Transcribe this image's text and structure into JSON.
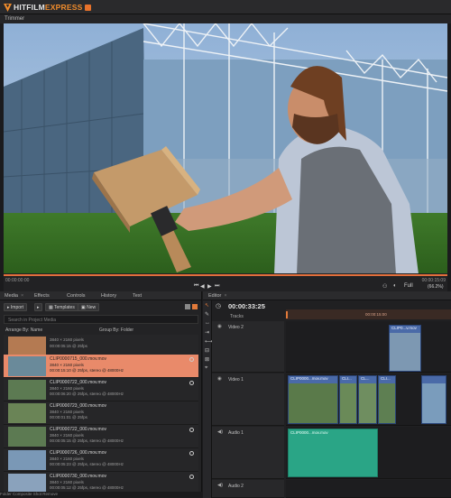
{
  "app": {
    "brand_hit": "HITFILM",
    "brand_express": "EXPRESS",
    "colors": {
      "accent": "#f08c2c",
      "selection": "#e98a6a",
      "audio_clip": "#2aa586",
      "video_clip": "#4a6aa8"
    }
  },
  "trimmer": {
    "tab_label": "Trimmer",
    "timecode_start": "00:00:00:00",
    "timecode_end": "00:00:15:09",
    "zoom_option": "Full",
    "zoom_level": "(66.2%)"
  },
  "media_panel": {
    "tabs": [
      "Media",
      "Effects",
      "Controls",
      "History",
      "Text"
    ],
    "import_label": "Import",
    "templates_label": "Templates",
    "new_label": "New",
    "search_placeholder": "Search in Project Media",
    "arrange_label": "Arrange By: Name",
    "group_label": "Group By: Folder",
    "items": [
      {
        "name": "",
        "res": "3840 × 2160 pixels",
        "meta": "00:00:05:15 @ 25fps"
      },
      {
        "name": "CLIP0000715_000.mov.mov",
        "res": "3840 × 2160 pixels",
        "meta": "00:00:15:10 @ 25fps, stereo @ 48000Hz"
      },
      {
        "name": "CLIP0000722_000.mov.mov",
        "res": "3840 × 2160 pixels",
        "meta": "00:00:06:20 @ 25fps, stereo @ 48000Hz"
      },
      {
        "name": "CLIP0000723_000.mov.mov",
        "res": "3840 × 2160 pixels",
        "meta": "00:00:01:01 @ 25fps"
      },
      {
        "name": "CLIP0000722_000.mov.mov",
        "res": "3840 × 2160 pixels",
        "meta": "00:00:05:15 @ 25fps, stereo @ 48000Hz"
      },
      {
        "name": "CLIP0000726_000.mov.mov",
        "res": "3840 × 2160 pixels",
        "meta": "00:00:05:23 @ 25fps, stereo @ 48000Hz"
      },
      {
        "name": "CLIP0000730_000.mov.mov",
        "res": "3840 × 2160 pixels",
        "meta": "00:00:05:12 @ 25fps, stereo @ 48000Hz"
      }
    ],
    "footer": "Folder      Composite Shot      Remove"
  },
  "editor": {
    "tab_label": "Editor",
    "timecode": "00:00:33:25",
    "ruler_mark": "00:00:15:00",
    "tracks_label": "Tracks",
    "tracks": {
      "video2": "Video 2",
      "video1": "Video 1",
      "audio1": "Audio 1",
      "audio2": "Audio 2"
    },
    "clips": {
      "v2": "CLIP0...v.mov",
      "v1a": "CLIP0000...mov.mov",
      "v1b": "CLI...",
      "v1c": "CL...",
      "v1d": "CLI...",
      "a1": "CLIP0000...mov.mov"
    }
  }
}
